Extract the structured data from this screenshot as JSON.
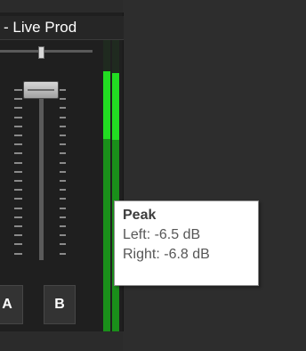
{
  "mixer": {
    "channel_title": "- Live Prod",
    "bus_a_label": "A",
    "bus_b_label": "B"
  },
  "meter": {
    "left_level_db": -6.5,
    "right_level_db": -6.8,
    "color_bright": "#22dd22",
    "color_dim": "#1a8f1a"
  },
  "tooltip": {
    "title": "Peak",
    "left_line": "Left: -6.5 dB",
    "right_line": "Right: -6.8 dB"
  }
}
